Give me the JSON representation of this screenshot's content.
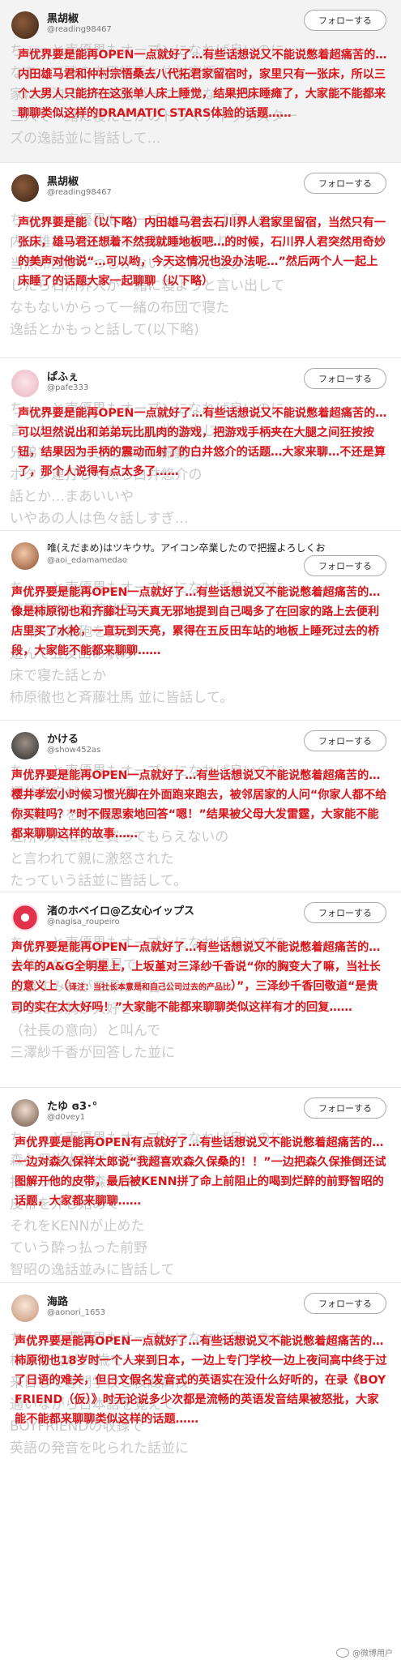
{
  "posts": [
    {
      "name": "黒胡椒",
      "handle": "@reading98467",
      "follow": "フォローする",
      "ghost": [
        "ちょっと声優界もオープンになれば良いのに",
        "なあって時の内田雄馬と仲村宗悟の",
        "家にお泊まりで布団が一つしかないから",
        "三人で一緒に寝たとかのドラマティックスター",
        "ズの逸話並に皆話して…"
      ],
      "text": "声优界要是能再OPEN一点就好了…有些话想说又不能说憋着超痛苦的…内田雄马君和仲村宗悟桑去八代拓君家留宿时，家里只有一张床，所以三个大男人只能挤在这张单人床上睡觉，结果把床睡瘫了，大家能不能都来聊聊类似这样的DRAMATIC STARS体验的话题……"
    },
    {
      "name": "黒胡椒",
      "handle": "@reading98467",
      "follow": "フォローする",
      "ghost": [
        "ちょっと声優界もオープンになれば良いのに",
        "内田雄馬が石川界人の家にお泊まりして",
        "当然布団が一つしかないので床で寝ようと",
        "したら石川界人が一緒に寝ようと言い出して",
        "なもないからって一緒の布団で寝た",
        "逸話とかもっと話して(以下略)"
      ],
      "text": "声优界要是能（以下略）内田雄马君去石川界人君家里留宿，当然只有一张床，雄马君还想着不然我就睡地板吧…的时候，石川界人君突然用奇妙的美声对他说“…可以哟，今天这情况也没办法呢…”然后两个人一起上床睡了的话题大家一起聊聊（以下略）"
    },
    {
      "name": "ぱふぇ",
      "handle": "@pafe333",
      "follow": "フォローする",
      "ghost": [
        "ちょっと声優界もオープンになれば良いのに",
        "言いたいことも言えない世の中じゃ",
        "兄弟でゲームしたとか、振動で",
        "ボタン連打してたら白井悠介の",
        "話とか…まあいいや",
        "いやあの人は色々話しすぎ…"
      ],
      "text": "声优界要是能再OPEN一点就好了…有些话想说又不能说憋着超痛苦的…可以坦然说出和弟弟玩比肌肉的游戏，把游戏手柄夹在大腿之间狂按按钮，结果因为手柄的震动而射了的白井悠介的话题…大家来聊…不还是算了，那个人说得有点太多了……"
    },
    {
      "name": "唯(えだまめ)はツキウサ。アイコン卒業したので把握よろしくお",
      "handle": "@aoi_edamamedao",
      "follow": "フォローする",
      "ghost": [
        "ちょっと声優界もオープンになれば良いのに",
        "柿原徹也と斉藤壮馬が",
        "一緒に水鉄砲を買って",
        "遊んで五反田の駅の",
        "床で寝た話とか",
        "柿原徹也と斉藤壮馬 並に皆話して。"
      ],
      "text": "声优界要是能再OPEN一点就好了…有些话想说又不能说憋着超痛苦的…像是柿原彻也和齐藤壮马天真无邪地提到自己喝多了在回家的路上去便利店里买了水枪，一直玩到天亮，累得在五反田车站的地板上睡死过去的桥段，大家能不能都来聊聊……"
    },
    {
      "name": "かける",
      "handle": "@show452as",
      "follow": "フォローする",
      "ghost": [
        "ちょっと声優界もオープンになれば良いのに",
        "櫻井孝宏が小さい頃",
        "裸足で外を走り回って",
        "近所の人に靴を買ってもらえないの",
        "と言われて親に激怒された",
        "たっていう話並に皆話して。"
      ],
      "text": "声优界要是能再OPEN一点就好了…有些话想说又不能说憋着超痛苦的…樱井孝宏小时候习惯光脚在外面跑来跑去，被邻居家的人问“你家人都不给你买鞋吗？”时不假思索地回答“嗯！”结果被父母大发雷霆，大家能不能都来聊聊这样的故事……"
    },
    {
      "name": "渚のホベイロ@乙女心イップス",
      "handle": "@nagisa_roupeiro",
      "follow": "フォローする",
      "ghost": [
        "ちょっと声優界もオープンになれば良いのに",
        "去年のA&G全明星で",
        "上坂すみれが三澤紗千香に",
        "あなたの胸が大好きです",
        "（社長の意向）と叫んで",
        "三澤紗千香が回答した並に"
      ],
      "text": "声优界要是能再OPEN一点就好了…有些话想说又不能说憋着超痛苦的…去年的A&G全明星上，上坂堇对三泽纱千香说“你的胸变大了嘛，当社长的意义上（",
      "note": "译注：当社长本意是和自己公司过去的产品比",
      "text_after": "）”，三泽纱千香回敬道“是贵司的实在太大好吗！”大家能不能都来聊聊类似这样有才的回复……"
    },
    {
      "name": "たゆ ɞ3･°",
      "handle": "@d0vey1",
      "follow": "フォローする",
      "ghost": [
        "ちょっと声優界もオープンになれば良いのに",
        "森久保祥太郎が大好きで",
        "抱きついたら森久保が",
        "皮帯を外し始めて",
        "それをKENNが止めた",
        "ていう酔っ払った前野",
        "智昭の逸話並みに皆話して"
      ],
      "text": "声优界要是能再OPEN有点就好了…有些话想说又不能说憋着超痛苦的…一边对森久保祥太郎说“我超喜欢森久保桑的！！”一边把森久保推倒还试图解开他的皮带，最后被KENN拼了命上前阻止的喝到烂醉的前野智昭的话题，大家都来聊聊……"
    },
    {
      "name": "海路",
      "handle": "@aonori_1653",
      "follow": "フォローする",
      "ghost": [
        "ちょっと声優界もオープンになれば良いのに",
        "柿原徹也が18歳で一人で",
        "来日して専門学校と夜間高校",
        "通いながら日本語を覚えて",
        "BOYFRIENDの収録で",
        "英語の発音を叱られた話並に"
      ],
      "text": "声优界要是能再OPEN一点就好了…有些话想说又不能说憋着超痛苦的…柿原彻也18岁时一个人来到日本，一边上专门学校一边上夜间高中终于过了日语的难关，但日文假名发音式的英语实在没什么好听的，在录《BOYFRIEND（仮）》时无论说多少次都是流畅的英语发音结果被怒批，大家能不能都来聊聊类似这样的话题……"
    }
  ],
  "watermark": "@微博用户"
}
